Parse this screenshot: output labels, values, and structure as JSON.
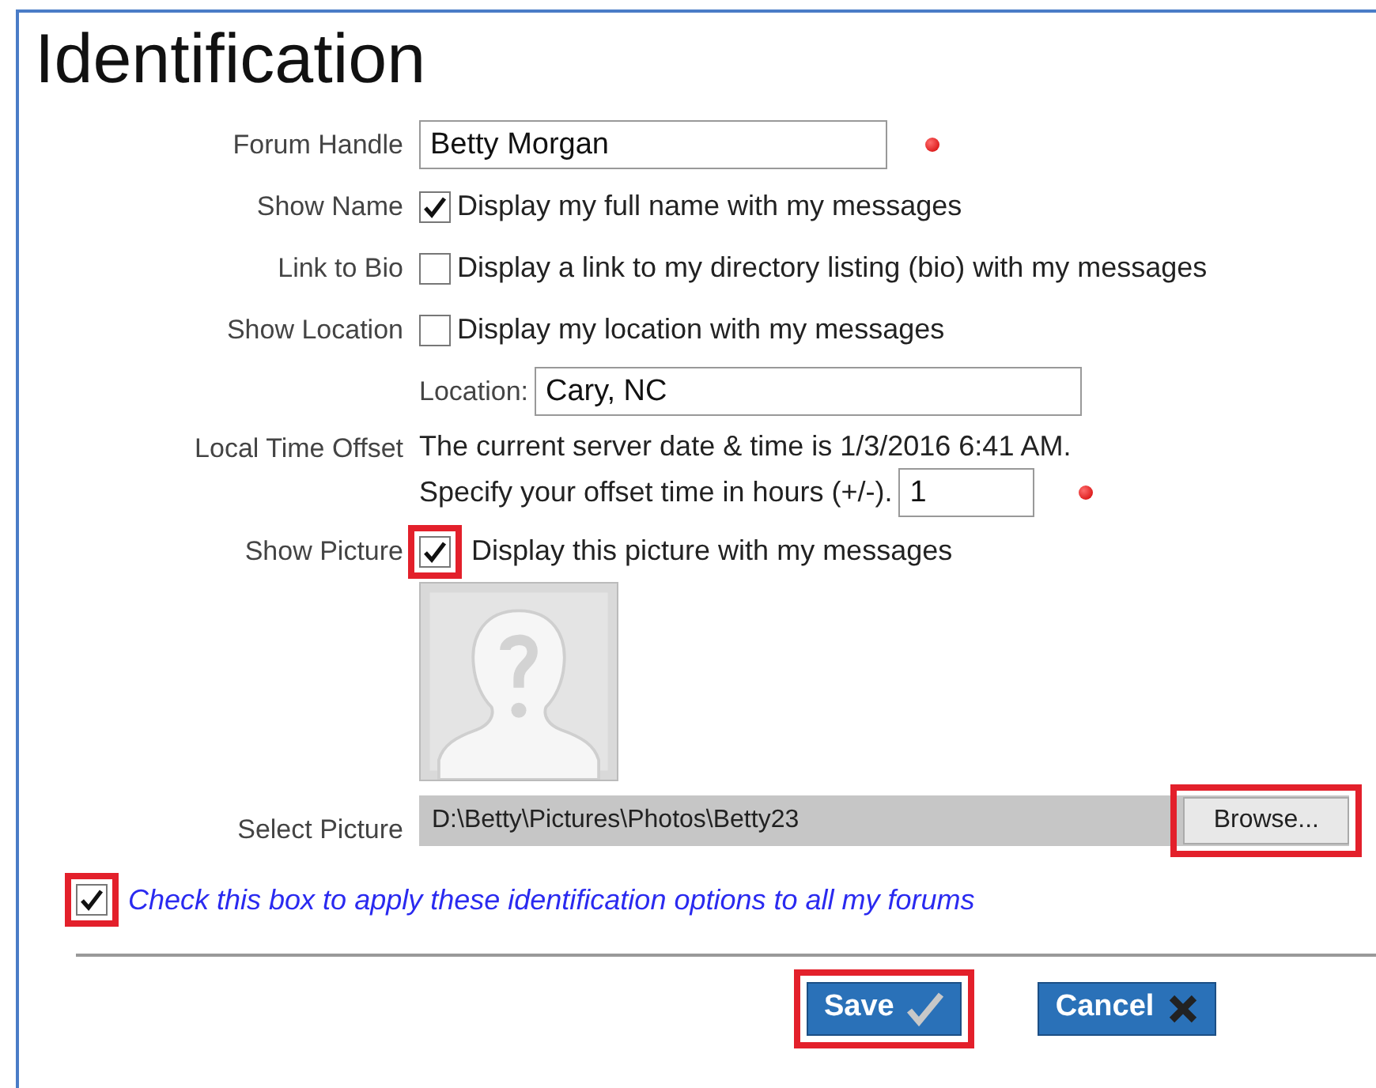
{
  "title": "Identification",
  "rows": [
    {
      "kind": "text",
      "label": "Forum Handle",
      "value": "Betty Morgan",
      "required": true
    },
    {
      "kind": "checkbox",
      "label": "Show Name",
      "text": "Display my full name with my messages",
      "checked": true
    },
    {
      "kind": "checkbox",
      "label": "Link to Bio",
      "text": "Display a link to my directory listing (bio) with my messages",
      "checked": false
    },
    {
      "kind": "checkbox",
      "label": "Show Location",
      "text": "Display my location with my messages",
      "checked": false
    },
    {
      "kind": "subfield",
      "label": "Location:",
      "value": "Cary, NC"
    },
    {
      "kind": "offset",
      "label": "Local Time Offset",
      "note": "The current server date & time is 1/3/2016 6:41 AM.",
      "prompt": "Specify your offset time in hours (+/-).",
      "value": "1",
      "required": true
    },
    {
      "kind": "checkbox",
      "label": "Show Picture",
      "text": "Display this picture with my messages",
      "checked": true,
      "highlighted": true
    },
    {
      "kind": "picture"
    },
    {
      "kind": "file",
      "label": "Select Picture",
      "value": "D:\\Betty\\Pictures\\Photos\\Betty23",
      "button": "Browse...",
      "highlighted": true
    }
  ],
  "apply_all": {
    "text": "Check this box to apply these identification options to all my forums",
    "checked": true,
    "highlighted": true
  },
  "buttons": [
    {
      "kind": "save",
      "label": "Save",
      "highlighted": true
    },
    {
      "kind": "cancel",
      "label": "Cancel"
    }
  ]
}
